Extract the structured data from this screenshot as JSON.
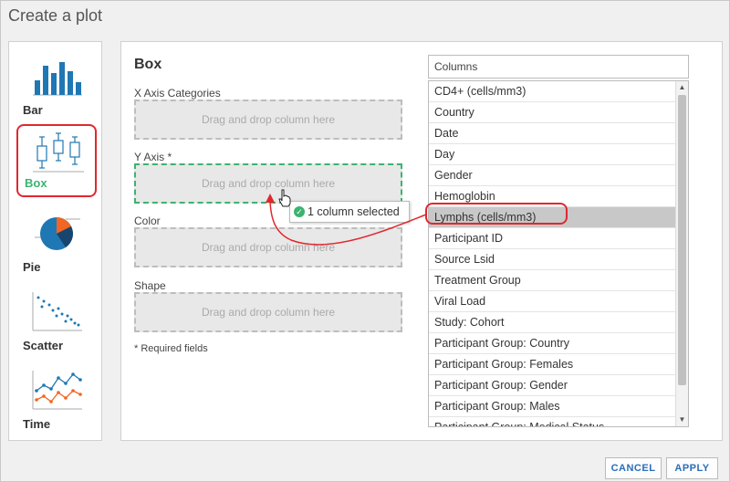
{
  "dialog": {
    "title": "Create a plot"
  },
  "chart_types": [
    {
      "label": "Bar",
      "selected": false
    },
    {
      "label": "Box",
      "selected": true
    },
    {
      "label": "Pie",
      "selected": false
    },
    {
      "label": "Scatter",
      "selected": false
    },
    {
      "label": "Time",
      "selected": false
    }
  ],
  "main": {
    "heading": "Box",
    "fields": [
      {
        "label": "X Axis Categories",
        "placeholder": "Drag and drop column here"
      },
      {
        "label": "Y Axis *",
        "placeholder": "Drag and drop column here"
      },
      {
        "label": "Color",
        "placeholder": "Drag and drop column here"
      },
      {
        "label": "Shape",
        "placeholder": "Drag and drop column here"
      }
    ],
    "required_note": "* Required fields"
  },
  "columns": {
    "header": "Columns",
    "items": [
      "CD4+ (cells/mm3)",
      "Country",
      "Date",
      "Day",
      "Gender",
      "Hemoglobin",
      "Lymphs (cells/mm3)",
      "Participant ID",
      "Source Lsid",
      "Treatment Group",
      "Viral Load",
      "Study: Cohort",
      "Participant Group: Country",
      "Participant Group: Females",
      "Participant Group: Gender",
      "Participant Group: Males",
      "Participant Group: Medical Status"
    ],
    "selected_index": 6
  },
  "drag_tooltip": {
    "text": "1 column selected"
  },
  "buttons": {
    "cancel": "CANCEL",
    "apply": "APPLY"
  },
  "colors": {
    "accent_green": "#3cb371",
    "callout_red": "#e0282e",
    "button_blue": "#2a6ebb",
    "bar_blue": "#1f77b4",
    "pie_orange": "#f26522"
  },
  "icons": {
    "check": "check-circle-icon",
    "cursor": "hand-cursor-icon",
    "scroll_up": "scroll-up-arrow-icon",
    "scroll_down": "scroll-down-arrow-icon"
  }
}
